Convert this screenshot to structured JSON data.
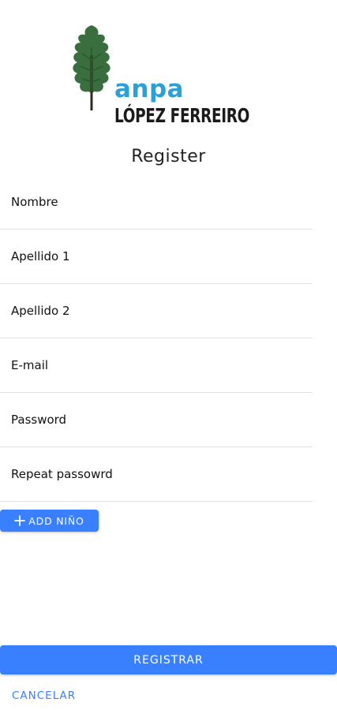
{
  "logo": {
    "line1": "anpa",
    "line2": "LÓPEZ FERREIRO",
    "icon": "oak-leaf-icon",
    "colors": {
      "leaf": "#3a6e3e",
      "line1": "#2a9fd8",
      "line2": "#1b1b1b"
    }
  },
  "page": {
    "title": "Register"
  },
  "form": {
    "fields": [
      {
        "placeholder": "Nombre",
        "value": ""
      },
      {
        "placeholder": "Apellido 1",
        "value": ""
      },
      {
        "placeholder": "Apellido 2",
        "value": ""
      },
      {
        "placeholder": "E-mail",
        "value": ""
      },
      {
        "placeholder": "Password",
        "value": ""
      },
      {
        "placeholder": "Repeat passowrd",
        "value": ""
      }
    ],
    "add_button": {
      "label": "ADD NIÑO",
      "icon": "plus-icon"
    }
  },
  "actions": {
    "register_label": "REGISTRAR",
    "cancel_label": "CANCELAR"
  },
  "colors": {
    "primary": "#3880ff",
    "divider": "#e3e3e3",
    "text": "#111111"
  }
}
